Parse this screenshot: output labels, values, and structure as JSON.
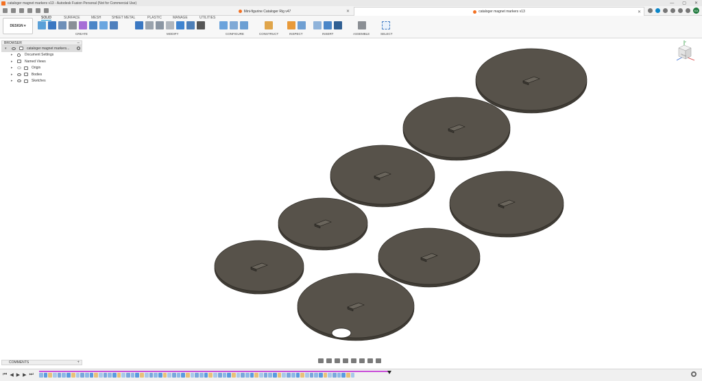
{
  "window": {
    "title": "cataloger magnet markers v13 - Autodesk Fusion Personal (Not for Commercial Use)"
  },
  "tabs": [
    {
      "label": "Mini-figurine Cataloger Rig v47",
      "active": false
    },
    {
      "label": "cataloger magnet markers v13",
      "active": true
    }
  ],
  "ribbon": {
    "workspace": "DESIGN",
    "workspace_tabs": [
      "SOLID",
      "SURFACE",
      "MESH",
      "SHEET METAL",
      "PLASTIC",
      "MANAGE",
      "UTILITIES"
    ],
    "groups": [
      "CREATE",
      "MODIFY",
      "CONFIGURE",
      "CONSTRUCT",
      "INSPECT",
      "INSERT",
      "ASSEMBLE",
      "SELECT"
    ]
  },
  "browser": {
    "title": "BROWSER",
    "root": "cataloger magnet markers...",
    "items": [
      "Document Settings",
      "Named Views",
      "Origin",
      "Bodies",
      "Sketches"
    ]
  },
  "comments": {
    "label": "COMMENTS"
  },
  "viewcube": {
    "label": "FRONT",
    "axis_z": "Z",
    "axis_x": "X",
    "axis_y": "Y"
  },
  "colors": {
    "accent": "#0696d7",
    "timeline_bar": "#c84bd8",
    "disc_top": "#57524a",
    "disc_edge": "#403c35",
    "viewport_bg": "#ffffff"
  },
  "timeline": {
    "feature_count": 69
  }
}
